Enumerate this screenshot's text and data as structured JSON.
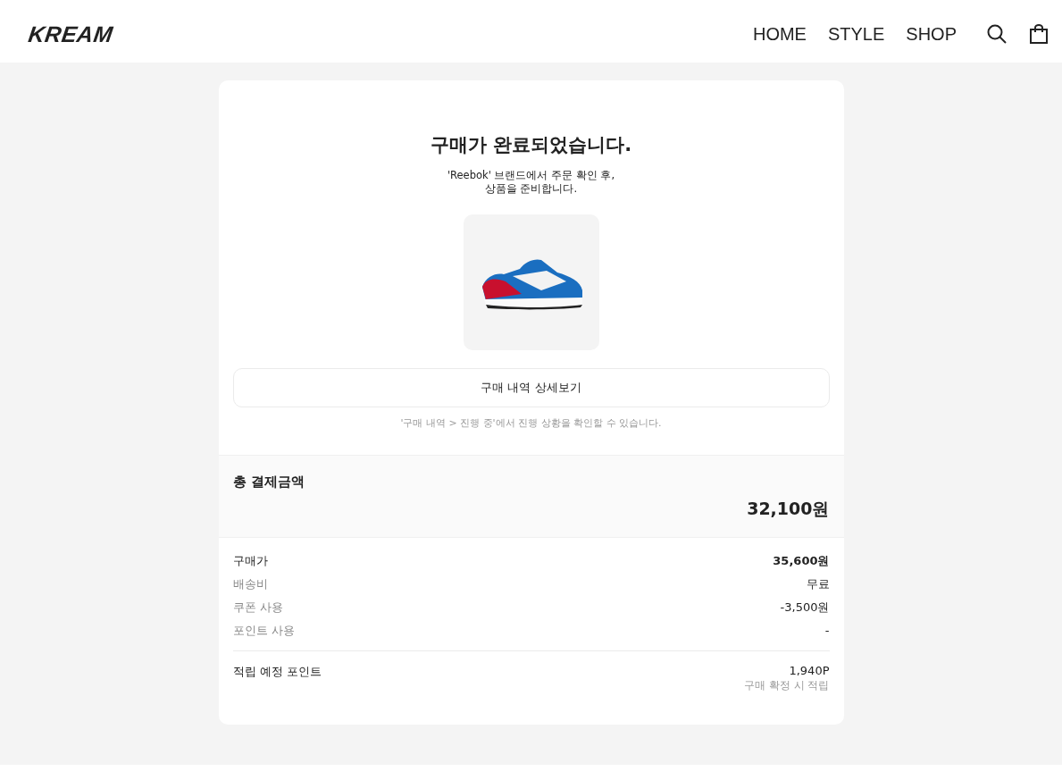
{
  "header": {
    "logo": "KREAM",
    "nav": [
      "HOME",
      "STYLE",
      "SHOP"
    ]
  },
  "order": {
    "title": "구매가 완료되었습니다.",
    "subtitle_lines": [
      "'Reebok' 브랜드에서 주문 확인 후,",
      "상품을 준비합니다."
    ],
    "detail_button": "구매 내역 상세보기",
    "note": "'구매 내역 > 진행 중'에서 진행 상황을 확인할 수 있습니다."
  },
  "total": {
    "label": "총 결제금액",
    "amount": "32,100원"
  },
  "breakdown": [
    {
      "label": "구매가",
      "value": "35,600원",
      "highlighted": true
    },
    {
      "label": "배송비",
      "value": "무료",
      "highlighted": false
    },
    {
      "label": "쿠폰 사용",
      "value": "-3,500원",
      "highlighted": false
    },
    {
      "label": "포인트 사용",
      "value": "-",
      "highlighted": false
    }
  ],
  "points": {
    "label": "적립 예정 포인트",
    "value": "1,940P",
    "note": "구매 확정 시 적립"
  }
}
